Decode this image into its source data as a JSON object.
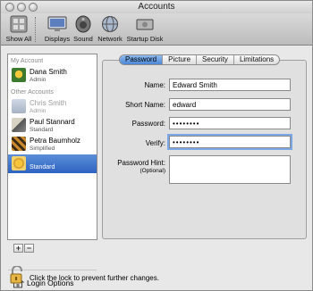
{
  "window": {
    "title": "Accounts"
  },
  "toolbar": {
    "items": [
      {
        "label": "Show All",
        "icon": "apple-grid-icon"
      },
      {
        "label": "Displays",
        "icon": "display-icon"
      },
      {
        "label": "Sound",
        "icon": "speaker-icon"
      },
      {
        "label": "Network",
        "icon": "network-globe-icon"
      },
      {
        "label": "Startup Disk",
        "icon": "hard-disk-icon"
      }
    ]
  },
  "sidebar": {
    "my_account_header": "My Account",
    "other_accounts_header": "Other Accounts",
    "my_account": {
      "name": "Dana Smith",
      "role": "Admin"
    },
    "others": [
      {
        "name": "Chris Smith",
        "role": "Admin"
      },
      {
        "name": "Paul Stannard",
        "role": "Standard"
      },
      {
        "name": "Petra Baumholz",
        "role": "Simplified"
      },
      {
        "name": "",
        "role": "Standard"
      }
    ],
    "login_options": "Login Options",
    "add": "+",
    "remove": "−"
  },
  "tabs": [
    "Password",
    "Picture",
    "Security",
    "Limitations"
  ],
  "form": {
    "name_label": "Name:",
    "name_value": "Edward Smith",
    "short_label": "Short Name:",
    "short_value": "edward",
    "password_label": "Password:",
    "password_value": "••••••••",
    "verify_label": "Verify:",
    "verify_value": "••••••••",
    "hint_label": "Password Hint:",
    "hint_sub": "(Optional)",
    "hint_value": ""
  },
  "footer": {
    "lock_text": "Click the lock to prevent further changes."
  },
  "colors": {
    "selection": "#3b6fcb",
    "tab_active": "#6aa2e6"
  }
}
